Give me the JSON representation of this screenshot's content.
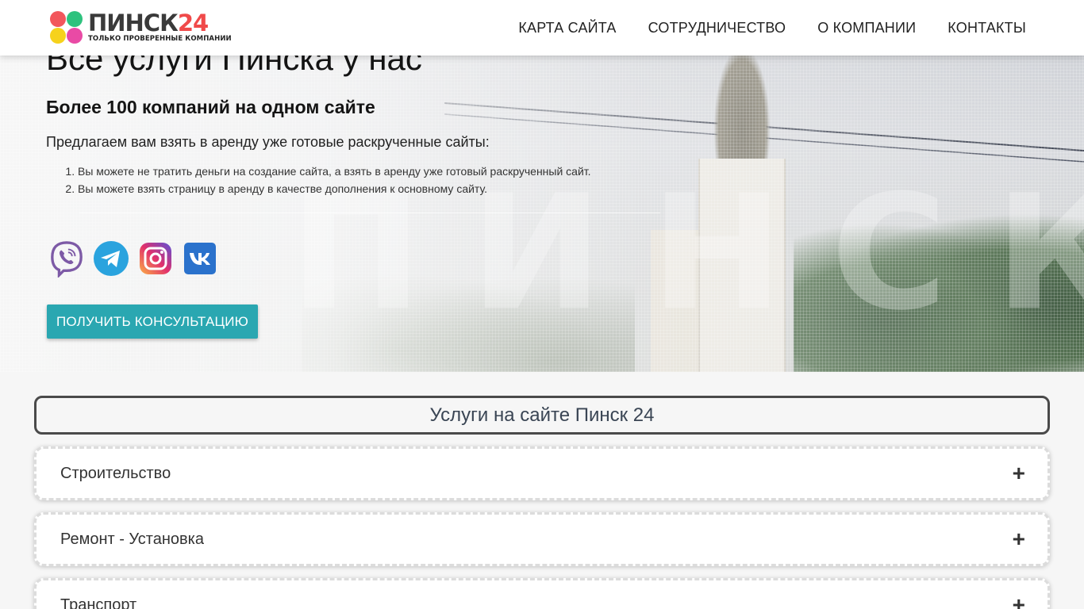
{
  "header": {
    "logo_text": "ПИНСК",
    "logo_num": "24",
    "logo_tagline": "ТОЛЬКО ПРОВЕРЕННЫЕ КОМПАНИИ",
    "nav": [
      "КАРТА САЙТА",
      "СОТРУДНИЧЕСТВО",
      "О КОМПАНИИ",
      "КОНТАКТЫ"
    ]
  },
  "hero": {
    "title": "Все услуги Пинска у нас",
    "subtitle": "Более 100 компаний на одном сайте",
    "lead": "Предлагаем вам взять в аренду уже готовые раскрученные сайты:",
    "list": [
      "Вы можете не тратить деньги на создание сайта, а взять в аренду уже готовый раскрученный сайт.",
      "Вы можете взять страницу в аренду в качестве дополнения к основному сайту."
    ],
    "watermark": "ПИНСК",
    "socials": [
      "viber-icon",
      "telegram-icon",
      "instagram-icon",
      "vk-icon"
    ],
    "cta": "ПОЛУЧИТЬ КОНСУЛЬТАЦИЮ"
  },
  "services": {
    "title": "Услуги на сайте Пинск 24",
    "items": [
      "Строительство",
      "Ремонт - Установка",
      "Транспорт"
    ],
    "expand_symbol": "+"
  },
  "colors": {
    "accent": "#2aa7b1",
    "logo_red": "#f04a4a",
    "title_box_text": "#3a4554"
  }
}
